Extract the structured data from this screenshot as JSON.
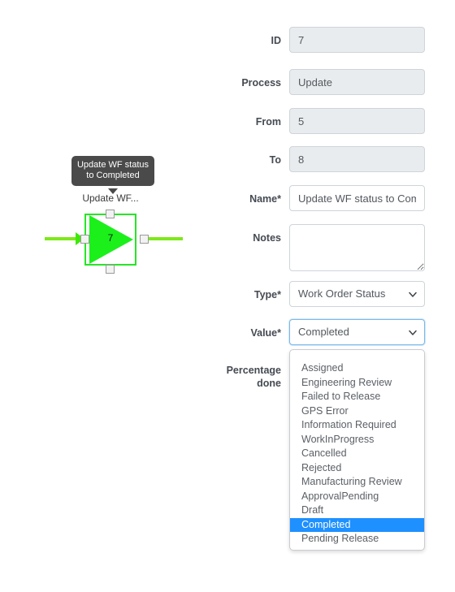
{
  "diagram": {
    "tooltip_text": "Update WF status to Completed",
    "node_label": "Update WF...",
    "node_id": "7",
    "node_shape": "triangle-right",
    "node_color": "#1bf01b",
    "node_border_color": "#27e527",
    "connector_color": "#7ee81a",
    "tooltip_bg": "#4a4a4a",
    "handles": [
      "top",
      "right",
      "bottom",
      "left"
    ]
  },
  "form": {
    "fields": [
      {
        "label": "ID",
        "value": "7",
        "type": "text",
        "disabled": true
      },
      {
        "label": "Process",
        "value": "Update",
        "type": "text",
        "disabled": true
      },
      {
        "label": "From",
        "value": "5",
        "type": "text",
        "disabled": true
      },
      {
        "label": "To",
        "value": "8",
        "type": "text",
        "disabled": true
      },
      {
        "label": "Name*",
        "value": "Update WF status to Completed",
        "type": "text",
        "disabled": false
      },
      {
        "label": "Notes",
        "value": "",
        "type": "textarea",
        "disabled": false
      },
      {
        "label": "Type*",
        "value": "Work Order Status",
        "type": "select",
        "disabled": false
      },
      {
        "label": "Value*",
        "value": "Completed",
        "type": "select",
        "disabled": false,
        "focused": true
      },
      {
        "label": "Percentage done",
        "value": "",
        "type": "empty",
        "disabled": false
      }
    ]
  },
  "value_dropdown": {
    "open": true,
    "selected": "Completed",
    "highlight_color": "#1e90ff",
    "options": [
      "Assigned",
      "Engineering Review",
      "Failed to Release",
      "GPS Error",
      "Information Required",
      "WorkInProgress",
      "Cancelled",
      "Rejected",
      "Manufacturing Review",
      "ApprovalPending",
      "Draft",
      "Completed",
      "Pending Release"
    ]
  }
}
